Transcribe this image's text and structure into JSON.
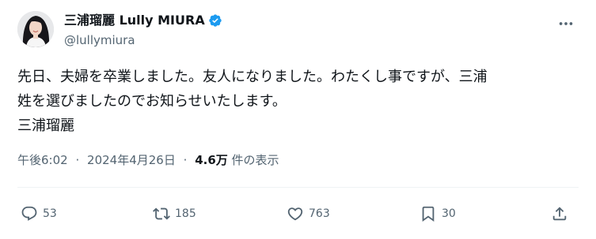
{
  "author": {
    "display_name": "三浦瑠麗 Lully MIURA",
    "handle": "@lullymiura",
    "verified_color": "#1d9bf0"
  },
  "tweet": {
    "lines": [
      "先日、夫婦を卒業しました。友人になりました。わたくし事ですが、三浦",
      "姓を選びましたのでお知らせいたします。",
      "三浦瑠麗"
    ]
  },
  "meta": {
    "time": "午後6:02",
    "date": "2024年4月26日",
    "views_count": "4.6万",
    "views_label": "件の表示",
    "separator": "·"
  },
  "actions": {
    "reply_count": "53",
    "retweet_count": "185",
    "like_count": "763",
    "bookmark_count": "30"
  },
  "icons": {
    "more": "more-horizontal-icon",
    "reply": "reply-icon",
    "retweet": "retweet-icon",
    "like": "heart-icon",
    "bookmark": "bookmark-icon",
    "share": "share-icon",
    "verified": "verified-badge-icon"
  },
  "colors": {
    "text_primary": "#0f1419",
    "text_secondary": "#536471",
    "divider": "#eff3f4",
    "accent": "#1d9bf0"
  }
}
